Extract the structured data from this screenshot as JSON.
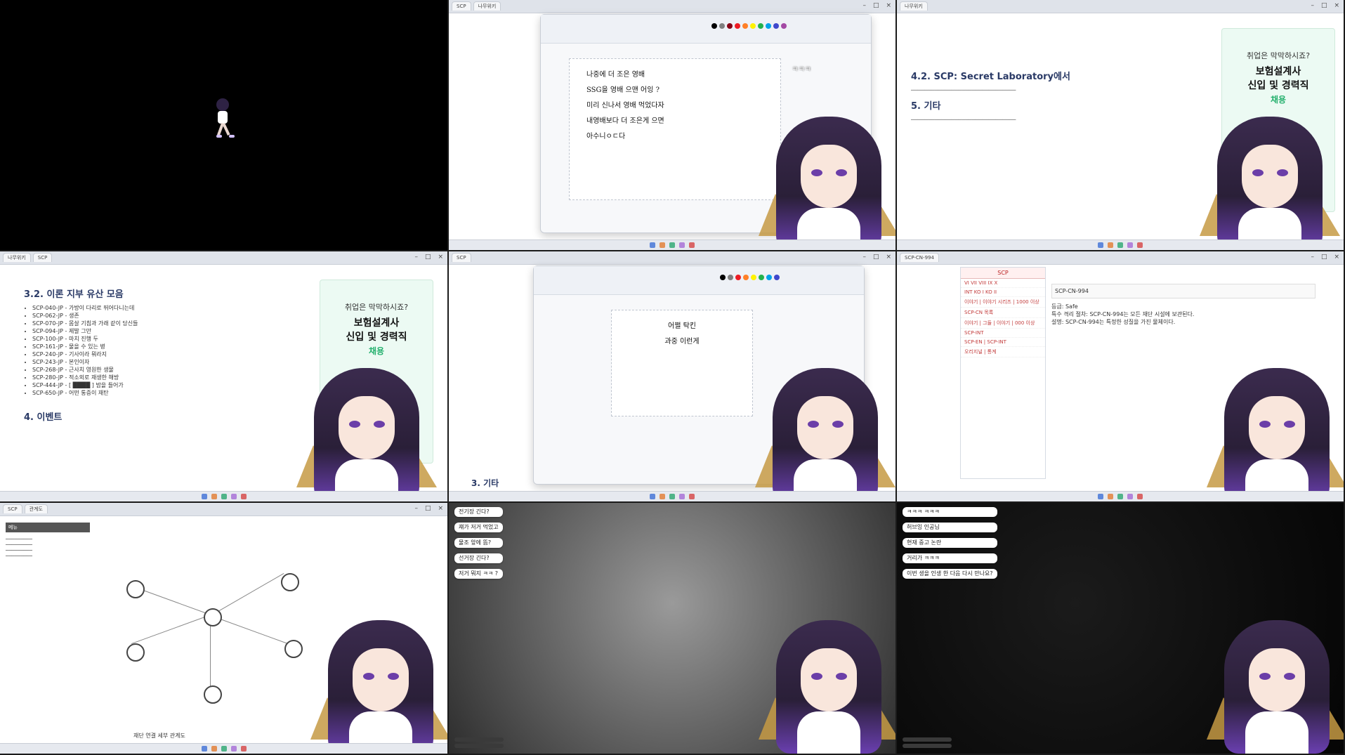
{
  "tile2": {
    "handwriting": [
      "나중에 더 조은 영배",
      "SSG을 영배 으맨 어잉 ?",
      "미리 신나서 영배 먹었다자",
      "내영배보다 더 조은게 으면",
      "아수니ㅇㄷ다"
    ],
    "overlay_caption": "ㅋㅋㅋ"
  },
  "tile3": {
    "section_title": "4.2. SCP: Secret Laboratory에서",
    "section_title_2": "5. 기타",
    "ad": {
      "line1": "취업은 막막하시죠?",
      "line2": "보험설계사",
      "line3": "신입 및 경력직",
      "line4": "채용"
    }
  },
  "tile4": {
    "section_title": "3.2. 이론 지부 유산 모음",
    "list": [
      "SCP-040-JP - 가방이 다리로 뛰어다니는데",
      "SCP-062-JP - 생존",
      "SCP-070-JP - 몸살 기침과 가래 같이 당신들",
      "SCP-094-JP - 제발 그만",
      "SCP-100-JP - 마치 진행 두",
      "SCP-161-JP - 물을 수 있는 병",
      "SCP-240-JP - 기사이라 뭐라지",
      "SCP-243-JP - 본인이자",
      "SCP-268-JP - 근사치 영원한 생물",
      "SCP-280-JP - 적소외로 재생한 해방",
      "SCP-444-JP - [ ████ ] 밤을 들어가",
      "SCP-650-JP - 어떤 통증이 재탄"
    ],
    "section_title_2": "4. 이벤트",
    "ad": {
      "line1": "취업은 막막하시죠?",
      "line2": "보험설계사",
      "line3": "신입 및 경력직",
      "line4": "채용"
    }
  },
  "tile5": {
    "handwriting": [
      "어쩔 탁킨",
      "과중 이런게"
    ],
    "section_title": "3. 기타"
  },
  "tile6": {
    "sidebar_items": [
      "VI VII VIII IX X",
      "INT KO I KO II",
      "이야기 | 이야기 시리즈 | 1000 이상",
      "SCP-CN 목록",
      "이야기 | 그들 | 이야기 | 000 이상",
      "SCP-INT",
      "SCP-EN | SCP-INT",
      "오리지널 | 통계"
    ],
    "infobox_title": "SCP-CN-994",
    "article_lines": [
      "등급: Safe",
      "특수 격리 절차: SCP-CN-994는 모든 재단 시설에 보관된다.",
      "설명: SCP-CN-994는 특정한 성질을 가진 물체이다."
    ]
  },
  "tile7": {
    "footer": "재단 연결 세부 관계도"
  },
  "tile8": {
    "chat": [
      "전기장 긴다?",
      "쟤가 저거 먹었고",
      "물조 앞에 뜸?",
      "선거장 긴다?",
      "저거 뭐지 ㅋㅋ ?"
    ]
  },
  "tile9": {
    "chat": [
      "ㅋㅋㅋ ㅋㅋㅋ",
      "허브잉 인공님",
      "현재 중고 논란",
      "거리가 ㅋㅋㅋ",
      "이번 생을 인생 한 다음 다시 만나요?"
    ]
  }
}
